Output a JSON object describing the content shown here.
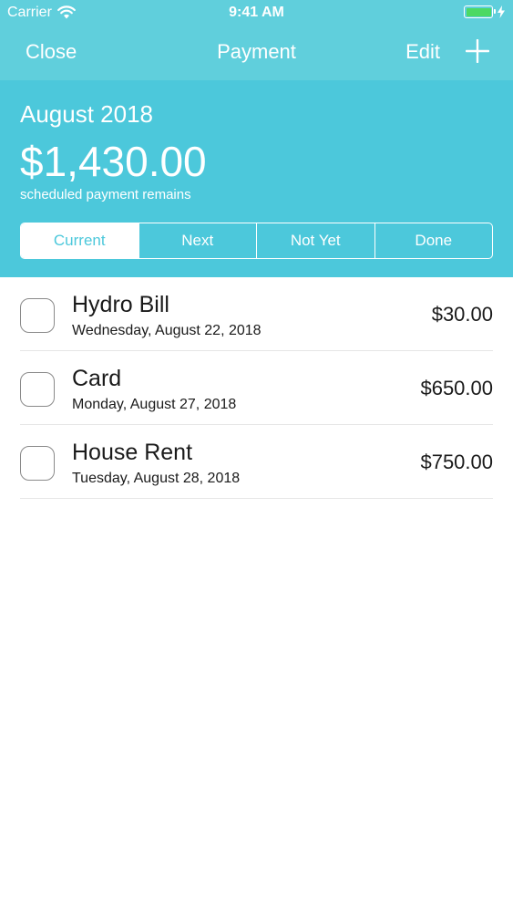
{
  "status_bar": {
    "carrier": "Carrier",
    "time": "9:41 AM",
    "battery_color": "#4cd964"
  },
  "nav": {
    "close_label": "Close",
    "title": "Payment",
    "edit_label": "Edit",
    "add_icon": "plus-icon"
  },
  "summary": {
    "month": "August 2018",
    "amount": "$1,430.00",
    "caption": "scheduled payment remains"
  },
  "tabs": [
    {
      "label": "Current",
      "selected": true
    },
    {
      "label": "Next",
      "selected": false
    },
    {
      "label": "Not Yet",
      "selected": false
    },
    {
      "label": "Done",
      "selected": false
    }
  ],
  "payments": [
    {
      "title": "Hydro Bill",
      "date": "Wednesday, August 22, 2018",
      "amount": "$30.00",
      "checked": false
    },
    {
      "title": "Card",
      "date": "Monday, August 27, 2018",
      "amount": "$650.00",
      "checked": false
    },
    {
      "title": "House Rent",
      "date": "Tuesday, August 28, 2018",
      "amount": "$750.00",
      "checked": false
    }
  ],
  "colors": {
    "header_bg": "#4cc8db",
    "topbar_bg": "#60cfdc",
    "text_primary": "#1a1a1a"
  }
}
